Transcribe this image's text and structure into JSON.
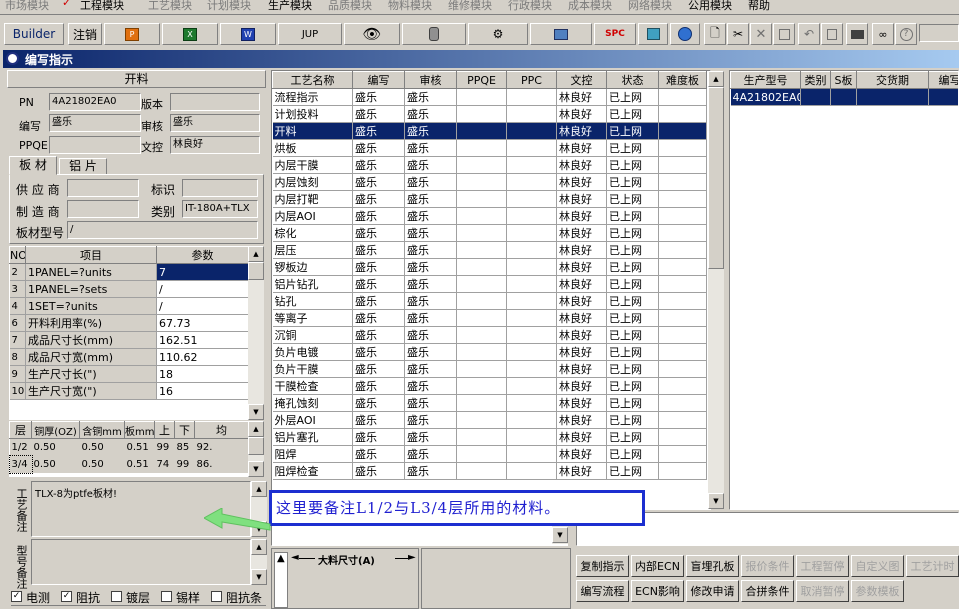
{
  "menu": [
    "市场模块",
    "工程模块",
    "工艺模块",
    "计划模块",
    "生产模块",
    "品质模块",
    "物料模块",
    "维修模块",
    "行政模块",
    "成本模块",
    "网络模块",
    "公用模块",
    "帮助"
  ],
  "toolbar": {
    "builder": "Builder",
    "logout": "注销",
    "jup": "JUP",
    "spc": "SPC"
  },
  "window_title": "编写指示",
  "left": {
    "header": "开料",
    "pn_label": "PN",
    "pn_value": "4A21802EA0",
    "version_label": "版本",
    "version_value": "",
    "author_label": "编写",
    "author_value": "盛乐",
    "review_label": "审核",
    "review_value": "盛乐",
    "ppqe_label": "PPQE",
    "ppqe_value": "",
    "control_label": "文控",
    "control_value": "林良好",
    "tab_board": "板 材",
    "tab_al": "铝 片",
    "supplier_label": "供 应 商",
    "supplier_value": "",
    "mark_label": "标识",
    "mark_value": "",
    "maker_label": "制 造 商",
    "maker_value": "",
    "category_label": "类别",
    "category_value": "IT-180A+TLX",
    "model_label": "板材型号",
    "model_value": "/",
    "param_headers": [
      "NO",
      "项目",
      "参数"
    ],
    "params": [
      [
        "2",
        "1PANEL=?units",
        "7"
      ],
      [
        "3",
        "1PANEL=?sets",
        "/"
      ],
      [
        "4",
        "1SET=?units",
        "/"
      ],
      [
        "6",
        "开料利用率(%)",
        "67.73"
      ],
      [
        "7",
        "成品尺寸长(mm)",
        "162.51"
      ],
      [
        "8",
        "成品尺寸宽(mm)",
        "110.62"
      ],
      [
        "9",
        "生产尺寸长(\")",
        "18"
      ],
      [
        "10",
        "生产尺寸宽(\")",
        "16"
      ]
    ],
    "layer_headers": [
      "层",
      "铜厚(OZ)",
      "含铜mm",
      "板mm",
      "上",
      "下",
      "均"
    ],
    "layers": [
      [
        "1/2",
        "0.50",
        "0.50",
        "0.51",
        "99",
        "85",
        "92."
      ],
      [
        "3/4",
        "0.50",
        "0.50",
        "0.51",
        "74",
        "99",
        "86."
      ]
    ],
    "process_note_label": "工艺备注",
    "process_note": "TLX-8为ptfe板材!",
    "model_note_label": "型号备注",
    "checks": [
      {
        "label": "电测",
        "checked": true
      },
      {
        "label": "阻抗",
        "checked": true
      },
      {
        "label": "镀层",
        "checked": false
      },
      {
        "label": "锡样",
        "checked": false
      },
      {
        "label": "阻抗条",
        "checked": false
      }
    ]
  },
  "process_table": {
    "headers": [
      "工艺名称",
      "编写",
      "审核",
      "PPQE",
      "PPC",
      "文控",
      "状态",
      "难度板"
    ],
    "rows": [
      [
        "流程指示",
        "盛乐",
        "盛乐",
        "",
        "",
        "林良好",
        "已上网",
        ""
      ],
      [
        "计划投料",
        "盛乐",
        "盛乐",
        "",
        "",
        "林良好",
        "已上网",
        ""
      ],
      [
        "开料",
        "盛乐",
        "盛乐",
        "",
        "",
        "林良好",
        "已上网",
        ""
      ],
      [
        "烘板",
        "盛乐",
        "盛乐",
        "",
        "",
        "林良好",
        "已上网",
        ""
      ],
      [
        "内层干膜",
        "盛乐",
        "盛乐",
        "",
        "",
        "林良好",
        "已上网",
        ""
      ],
      [
        "内层蚀刻",
        "盛乐",
        "盛乐",
        "",
        "",
        "林良好",
        "已上网",
        ""
      ],
      [
        "内层打靶",
        "盛乐",
        "盛乐",
        "",
        "",
        "林良好",
        "已上网",
        ""
      ],
      [
        "内层AOI",
        "盛乐",
        "盛乐",
        "",
        "",
        "林良好",
        "已上网",
        ""
      ],
      [
        "棕化",
        "盛乐",
        "盛乐",
        "",
        "",
        "林良好",
        "已上网",
        ""
      ],
      [
        "层压",
        "盛乐",
        "盛乐",
        "",
        "",
        "林良好",
        "已上网",
        ""
      ],
      [
        "锣板边",
        "盛乐",
        "盛乐",
        "",
        "",
        "林良好",
        "已上网",
        ""
      ],
      [
        "铝片钻孔",
        "盛乐",
        "盛乐",
        "",
        "",
        "林良好",
        "已上网",
        ""
      ],
      [
        "钻孔",
        "盛乐",
        "盛乐",
        "",
        "",
        "林良好",
        "已上网",
        ""
      ],
      [
        "等离子",
        "盛乐",
        "盛乐",
        "",
        "",
        "林良好",
        "已上网",
        ""
      ],
      [
        "沉铜",
        "盛乐",
        "盛乐",
        "",
        "",
        "林良好",
        "已上网",
        ""
      ],
      [
        "负片电镀",
        "盛乐",
        "盛乐",
        "",
        "",
        "林良好",
        "已上网",
        ""
      ],
      [
        "负片干膜",
        "盛乐",
        "盛乐",
        "",
        "",
        "林良好",
        "已上网",
        ""
      ],
      [
        "干膜检查",
        "盛乐",
        "盛乐",
        "",
        "",
        "林良好",
        "已上网",
        ""
      ],
      [
        "掩孔蚀刻",
        "盛乐",
        "盛乐",
        "",
        "",
        "林良好",
        "已上网",
        ""
      ],
      [
        "外层AOI",
        "盛乐",
        "盛乐",
        "",
        "",
        "林良好",
        "已上网",
        ""
      ],
      [
        "铝片塞孔",
        "盛乐",
        "盛乐",
        "",
        "",
        "林良好",
        "已上网",
        ""
      ],
      [
        "阻焊",
        "盛乐",
        "盛乐",
        "",
        "",
        "林良好",
        "已上网",
        ""
      ],
      [
        "阻焊检查",
        "盛乐",
        "盛乐",
        "",
        "",
        "林良好",
        "已上网",
        ""
      ]
    ],
    "selected_index": 2
  },
  "right_table": {
    "headers": [
      "生产型号",
      "类别",
      "S板",
      "交货期",
      "编写"
    ],
    "rows": [
      [
        "4A21802EA0",
        "",
        "",
        "",
        ""
      ]
    ]
  },
  "annotation": "这里要备注L1/2与L3/4层所用的材料。",
  "dimension_label": "大料尺寸(A)",
  "buttons_row1": [
    {
      "label": "复制指示",
      "enabled": true
    },
    {
      "label": "内部ECN",
      "enabled": true
    },
    {
      "label": "盲埋孔板",
      "enabled": true
    },
    {
      "label": "报价条件",
      "enabled": false
    },
    {
      "label": "工程暂停",
      "enabled": false
    },
    {
      "label": "自定义图",
      "enabled": false
    },
    {
      "label": "工艺计时",
      "enabled": false
    }
  ],
  "buttons_row2": [
    {
      "label": "编写流程",
      "enabled": true
    },
    {
      "label": "ECN影响",
      "enabled": true
    },
    {
      "label": "修改申请",
      "enabled": true
    },
    {
      "label": "合拼条件",
      "enabled": true
    },
    {
      "label": "取消暂停",
      "enabled": false
    },
    {
      "label": "参数模板",
      "enabled": false
    }
  ],
  "colors": {
    "selection": "#0a246a",
    "annotation_border": "#1c2fd0",
    "annotation_text": "#2020d0",
    "arrow": "#7fe07f"
  }
}
